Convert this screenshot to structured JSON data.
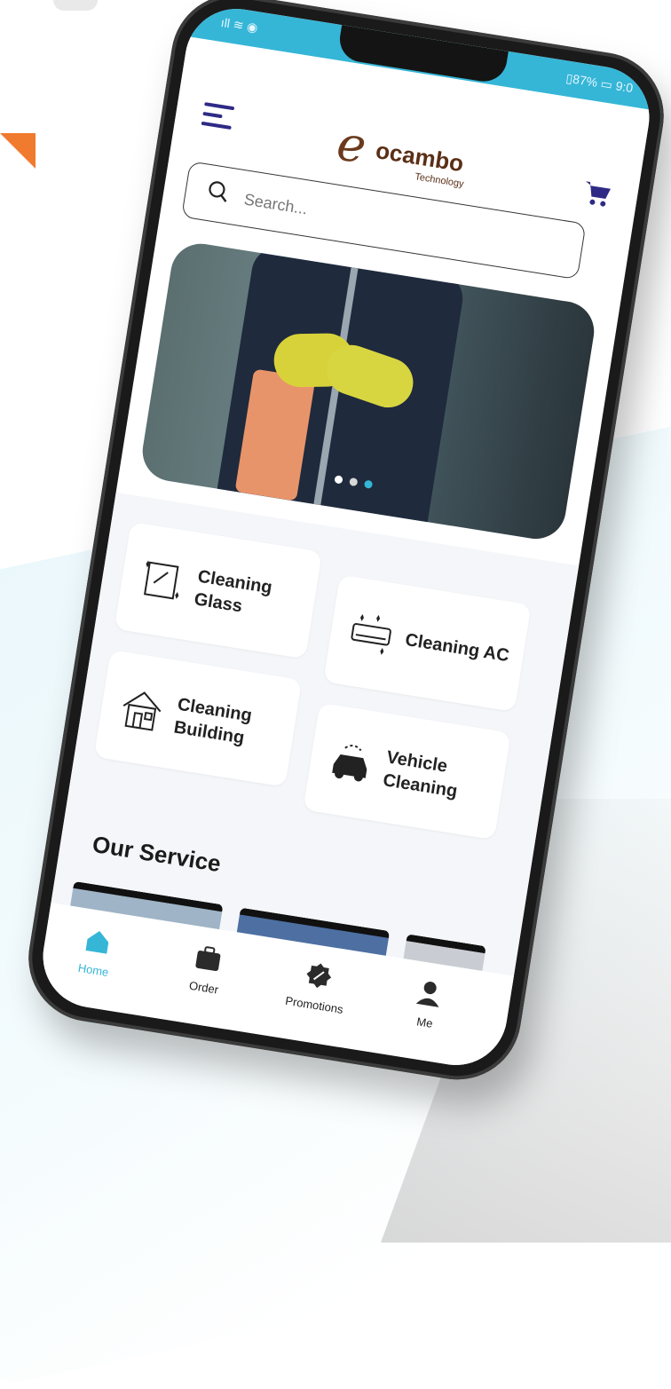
{
  "status": {
    "left": "ıll ≋ ◉",
    "right": "▯87% ▭ 9:0"
  },
  "app": {
    "logo_e": "e",
    "logo_word": "ocambo",
    "logo_sub": "Technology"
  },
  "search": {
    "placeholder": "Search..."
  },
  "categories": [
    {
      "label": "Cleaning Glass",
      "icon": "glass-icon"
    },
    {
      "label": "Cleaning AC",
      "icon": "ac-icon"
    },
    {
      "label": "Cleaning Building",
      "icon": "building-icon"
    },
    {
      "label": "Vehicle Cleaning",
      "icon": "car-icon"
    }
  ],
  "section": {
    "title": "Our Service"
  },
  "nav": [
    {
      "label": "Home",
      "icon": "home-icon",
      "active": true
    },
    {
      "label": "Order",
      "icon": "briefcase-icon",
      "active": false
    },
    {
      "label": "Promotions",
      "icon": "promotion-badge-icon",
      "active": false
    },
    {
      "label": "Me",
      "icon": "user-icon",
      "active": false
    }
  ],
  "colors": {
    "accent": "#35b6d7",
    "brand_brown": "#5b2f16",
    "menu": "#2e2a86",
    "orange": "#f07a2e"
  }
}
